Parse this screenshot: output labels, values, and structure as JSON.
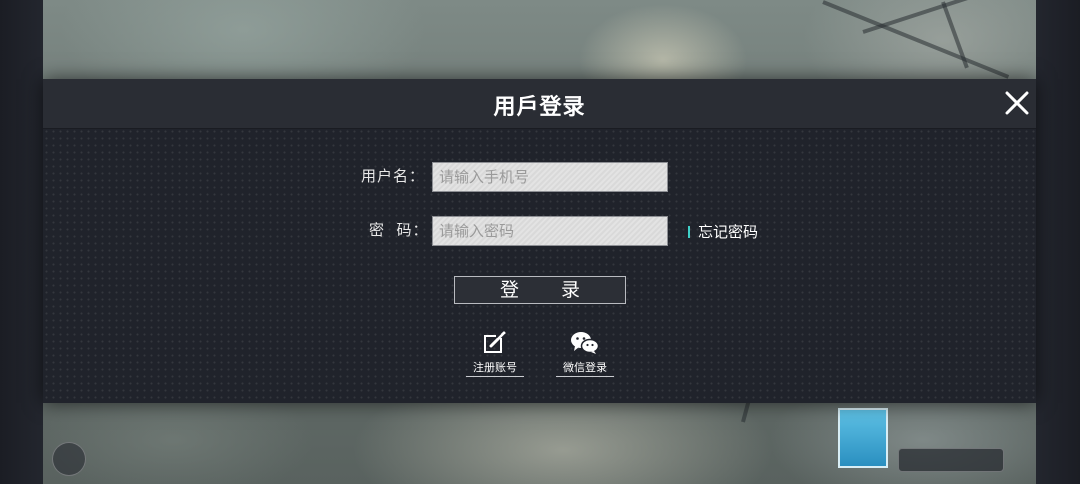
{
  "dialog": {
    "title": "用戶登录",
    "close_icon": "close-icon"
  },
  "form": {
    "username_label": "用户名：",
    "username_placeholder": "请输入手机号",
    "password_label": "密  码：",
    "password_placeholder": "请输入密码",
    "forgot_label": "忘记密码",
    "login_label": "登 录"
  },
  "social": [
    {
      "icon": "edit-icon",
      "label": "注册账号"
    },
    {
      "icon": "wechat-icon",
      "label": "微信登录"
    }
  ],
  "colors": {
    "dialog_bg": "#20232b",
    "header_bg": "#2a2d34",
    "accent": "#3fd0c8"
  }
}
